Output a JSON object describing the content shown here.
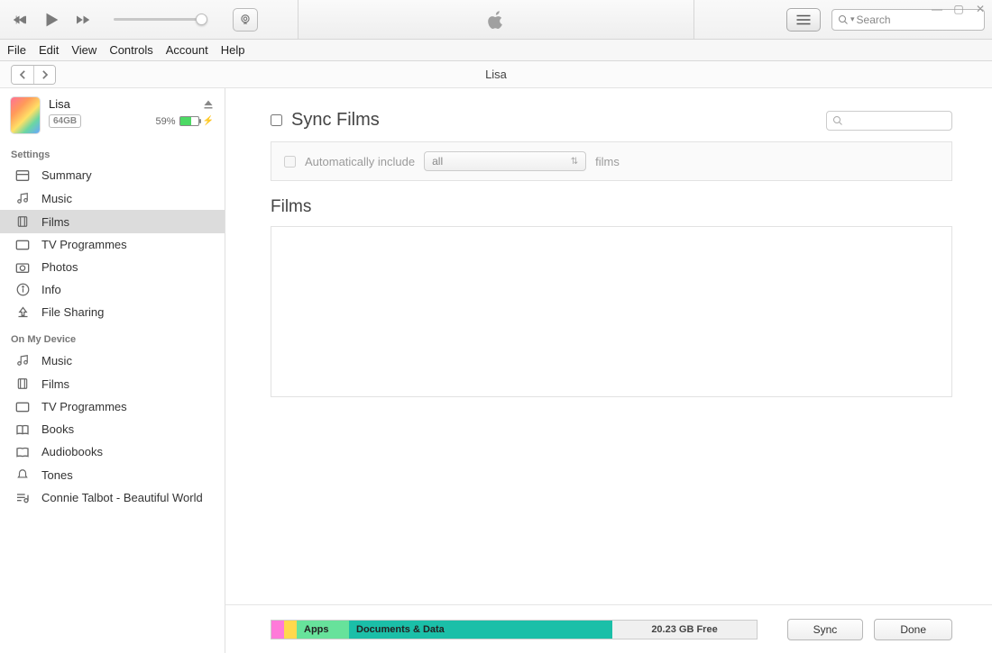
{
  "window": {
    "title": "Lisa"
  },
  "menu": {
    "file": "File",
    "edit": "Edit",
    "view": "View",
    "controls": "Controls",
    "account": "Account",
    "help": "Help"
  },
  "search": {
    "placeholder": "Search"
  },
  "device": {
    "name": "Lisa",
    "capacity": "64GB",
    "battery_pct": "59%"
  },
  "sidebar": {
    "settings_header": "Settings",
    "on_device_header": "On My Device",
    "settings": [
      {
        "label": "Summary"
      },
      {
        "label": "Music"
      },
      {
        "label": "Films"
      },
      {
        "label": "TV Programmes"
      },
      {
        "label": "Photos"
      },
      {
        "label": "Info"
      },
      {
        "label": "File Sharing"
      }
    ],
    "device": [
      {
        "label": "Music"
      },
      {
        "label": "Films"
      },
      {
        "label": "TV Programmes"
      },
      {
        "label": "Books"
      },
      {
        "label": "Audiobooks"
      },
      {
        "label": "Tones"
      },
      {
        "label": "Connie Talbot - Beautiful World"
      }
    ]
  },
  "main": {
    "sync_title": "Sync Films",
    "auto_label_pre": "Automatically include",
    "auto_dropdown": "all",
    "auto_label_post": "films",
    "films_header": "Films"
  },
  "storage": {
    "apps": "Apps",
    "docs": "Documents & Data",
    "free": "20.23 GB Free"
  },
  "buttons": {
    "sync": "Sync",
    "done": "Done"
  }
}
